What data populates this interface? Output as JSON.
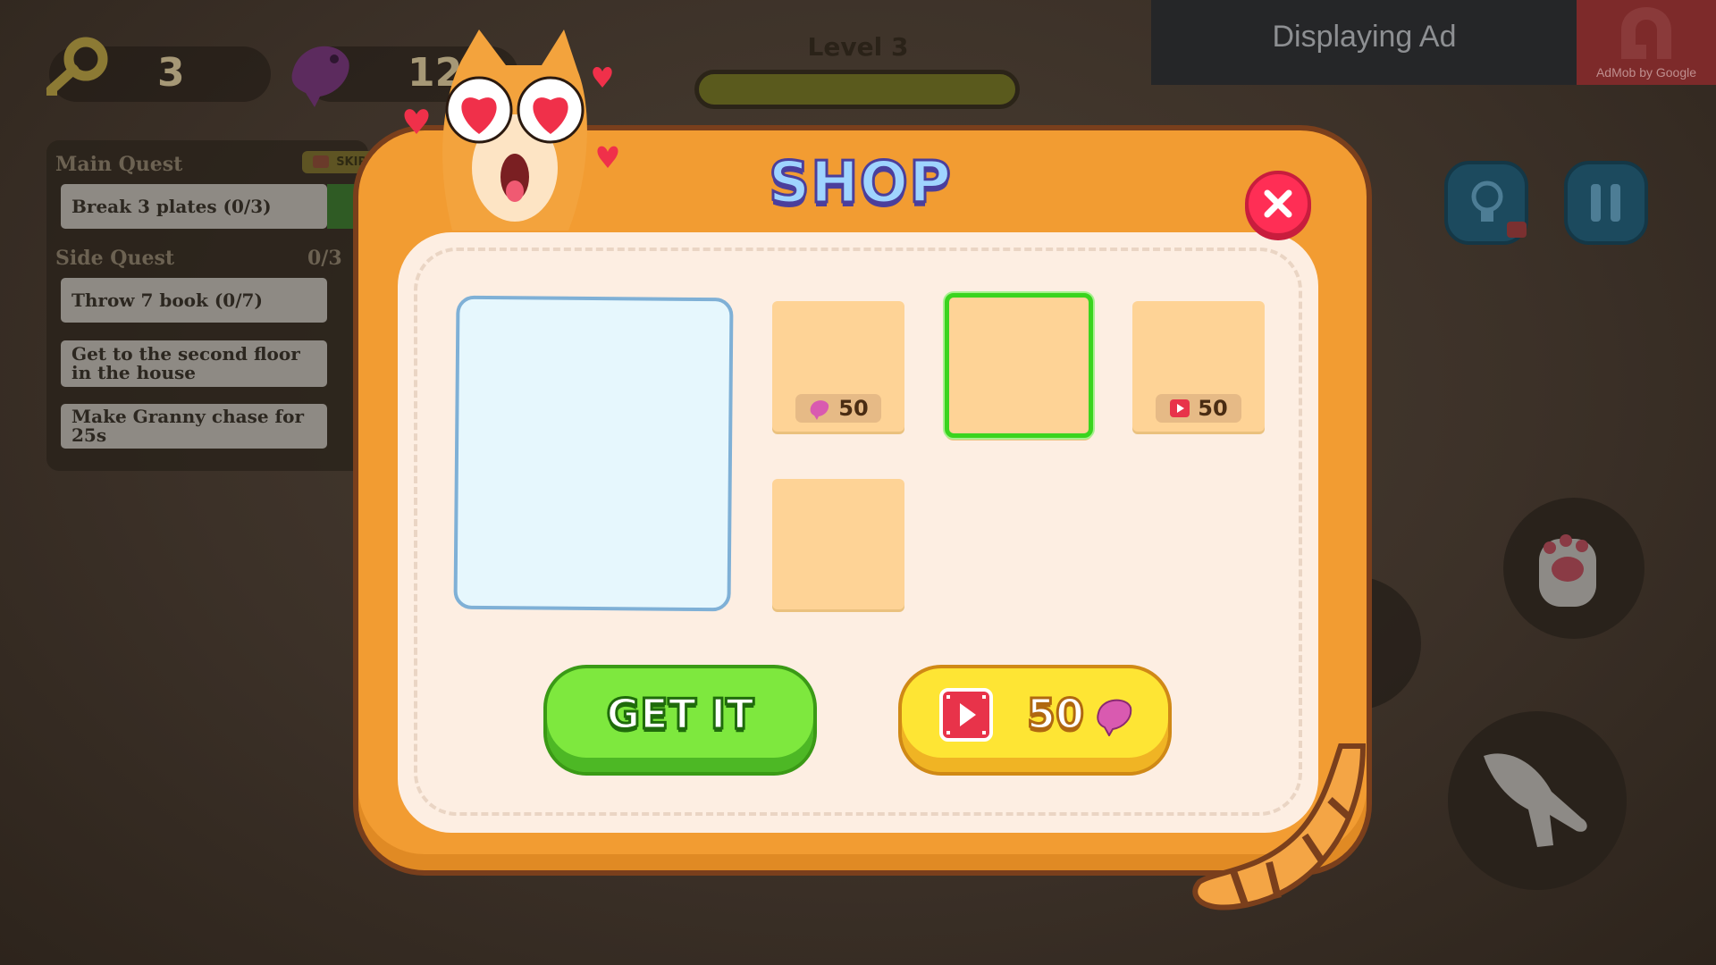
{
  "hud": {
    "keys_count": "3",
    "fish_count": "12",
    "level_label": "Level 3",
    "level_progress": 0.0
  },
  "ad_banner": {
    "text": "Displaying Ad",
    "provider": "AdMob by Google"
  },
  "quests": {
    "main_title": "Main Quest",
    "skip_label": "SKIP",
    "main_items": [
      {
        "label": "Break 3 plates (0/3)"
      }
    ],
    "side_title": "Side Quest",
    "side_progress": "0/3",
    "side_items": [
      {
        "label": "Throw 7 book (0/7)"
      },
      {
        "label": "Get to the second floor in the house"
      },
      {
        "label": "Make Granny chase for 25s"
      }
    ]
  },
  "shop": {
    "title": "SHOP",
    "items": [
      {
        "price": "50",
        "currency": "fish-icon"
      },
      {
        "selected": true
      },
      {
        "price": "50",
        "currency": "video-ad-icon"
      },
      {}
    ],
    "get_button_label": "GET IT",
    "ad_button_count": "50"
  },
  "colors": {
    "frame_orange": "#f29c32",
    "get_green": "#7ee83e",
    "ad_yellow": "#fee534",
    "close_red": "#ff2e55",
    "selected_green": "#3ad41e"
  }
}
